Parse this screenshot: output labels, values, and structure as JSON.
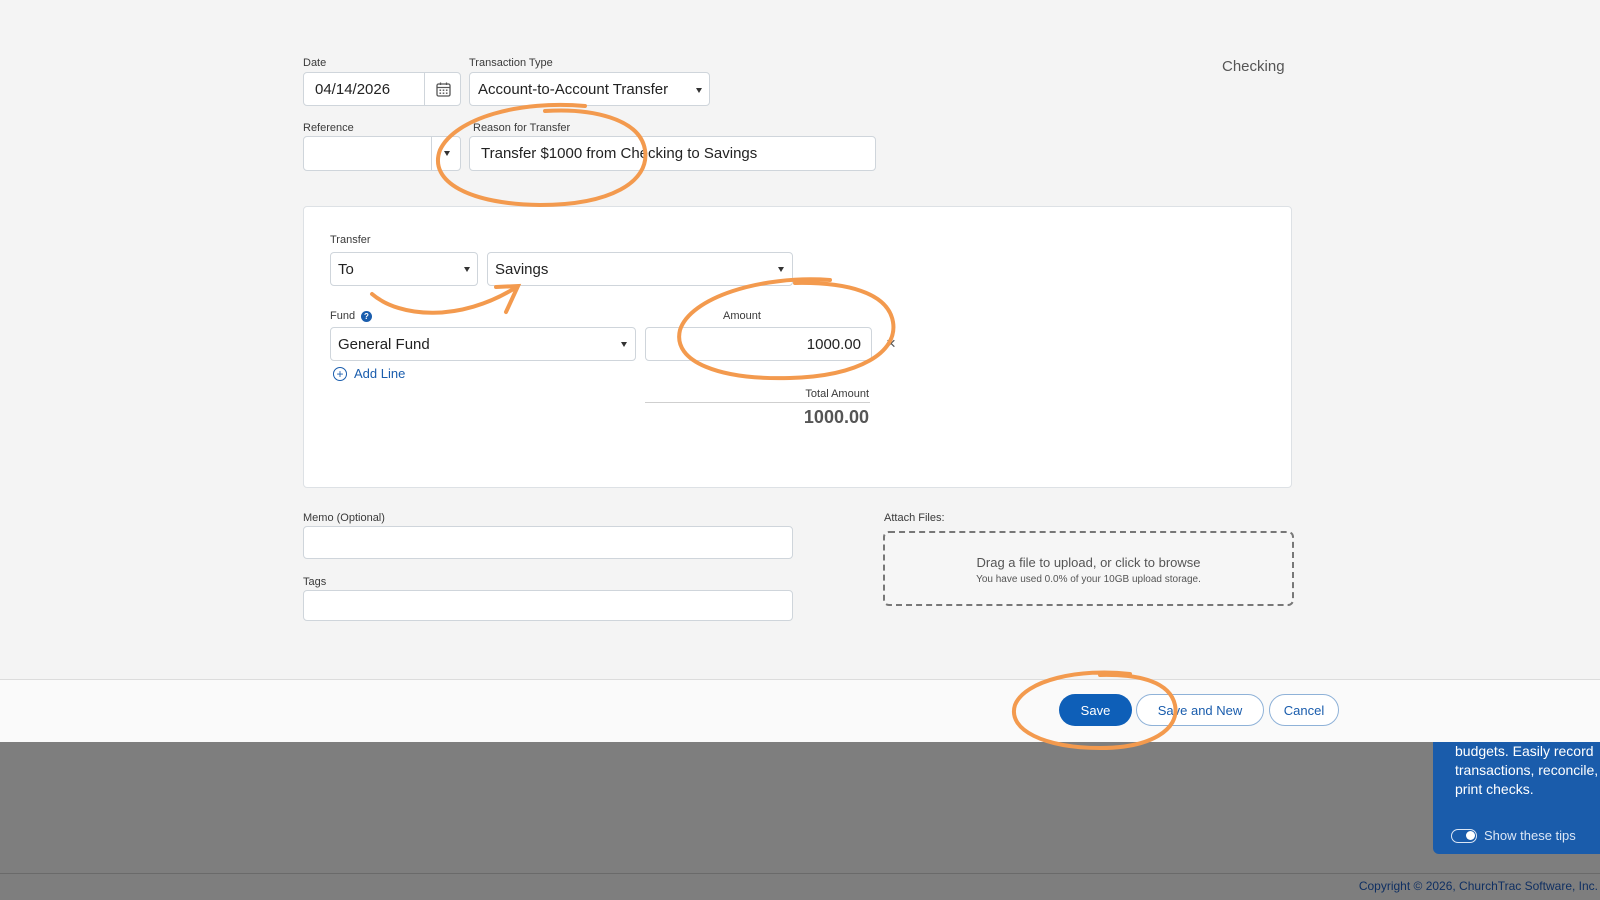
{
  "account": {
    "title": "Checking"
  },
  "form": {
    "date": {
      "label": "Date",
      "value": "04/14/2026"
    },
    "transaction_type": {
      "label": "Transaction Type",
      "value": "Account-to-Account Transfer"
    },
    "reference": {
      "label": "Reference",
      "value": ""
    },
    "reason": {
      "label": "Reason for Transfer",
      "value": "Transfer $1000 from Checking to Savings"
    }
  },
  "transfer": {
    "label": "Transfer",
    "direction": "To",
    "account": "Savings",
    "fund_label": "Fund",
    "fund": "General Fund",
    "amount_label": "Amount",
    "amount": "1000.00",
    "add_line": "Add Line",
    "total_label": "Total Amount",
    "total": "1000.00"
  },
  "memo": {
    "label": "Memo (Optional)",
    "value": ""
  },
  "tags": {
    "label": "Tags",
    "value": ""
  },
  "attach": {
    "label": "Attach Files:",
    "main": "Drag a file to upload, or click to browse",
    "sub": "You have used 0.0% of your 10GB upload storage."
  },
  "buttons": {
    "save": "Save",
    "save_new": "Save and New",
    "cancel": "Cancel"
  },
  "tips": {
    "text": "budgets. Easily record transactions, reconcile, print checks.",
    "toggle": "Show these tips"
  },
  "footer": {
    "copyright": "Copyright © 2026, ChurchTrac Software, Inc."
  },
  "colors": {
    "accent": "#0e5fb8",
    "annotation": "#f39a4e",
    "tip_panel": "#1a5cab"
  },
  "icons": {
    "calendar": "calendar-icon",
    "help": "help-icon",
    "add": "plus-circle-icon",
    "remove": "close-icon"
  }
}
